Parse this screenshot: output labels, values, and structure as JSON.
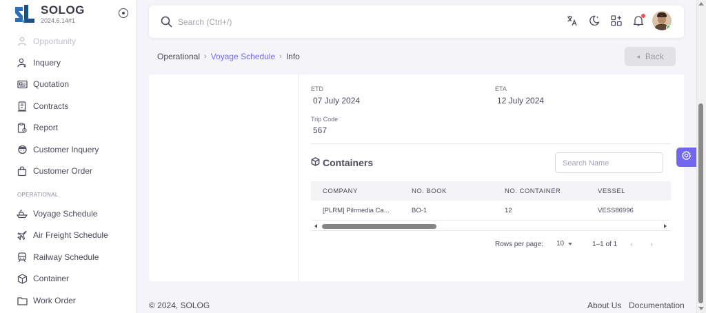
{
  "app": {
    "name": "SOLOG",
    "version": "2024.6.14#1"
  },
  "sidebar": {
    "items_top": [
      {
        "label": "Opportunity",
        "icon": "opportunity-icon"
      },
      {
        "label": "Inquery",
        "icon": "user-inquiry-icon"
      },
      {
        "label": "Quotation",
        "icon": "quotation-icon"
      },
      {
        "label": "Contracts",
        "icon": "contracts-icon"
      },
      {
        "label": "Report",
        "icon": "report-icon"
      },
      {
        "label": "Customer Inquery",
        "icon": "customer-inquiry-icon"
      },
      {
        "label": "Customer Order",
        "icon": "shopping-bag-icon"
      }
    ],
    "section_label": "OPERATIONAL",
    "items_operational": [
      {
        "label": "Voyage Schedule",
        "icon": "ship-icon"
      },
      {
        "label": "Air Freight Schedule",
        "icon": "plane-icon"
      },
      {
        "label": "Railway Schedule",
        "icon": "train-icon"
      },
      {
        "label": "Container",
        "icon": "box-icon"
      },
      {
        "label": "Work Order",
        "icon": "folder-icon"
      }
    ]
  },
  "topbar": {
    "search_placeholder": "Search (Ctrl+/)"
  },
  "breadcrumb": {
    "items": [
      "Operational",
      "Voyage Schedule",
      "Info"
    ],
    "separator": "›"
  },
  "back_button": {
    "label": "Back"
  },
  "info": {
    "etd_label": "ETD",
    "etd_value": "07 July 2024",
    "eta_label": "ETA",
    "eta_value": "12 July 2024",
    "trip_code_label": "Trip Code",
    "trip_code_value": "567"
  },
  "containers": {
    "title": "Containers",
    "search_placeholder": "Search Name",
    "columns": [
      "COMPANY",
      "NO. BOOK",
      "NO. CONTAINER",
      "VESSEL"
    ],
    "rows": [
      [
        "[PLRM] Pilrmedia Ca...",
        "BO-1",
        "12",
        "VESS86996"
      ]
    ],
    "rows_per_page_label": "Rows per page:",
    "rows_per_page_value": "10",
    "range_text": "1–1 of 1"
  },
  "footer": {
    "copyright": "© 2024, SOLOG",
    "links": [
      "About Us",
      "Documentation"
    ]
  },
  "colors": {
    "primary": "#7367f0",
    "text": "#4b4b5a",
    "notification": "#ff4c51",
    "online": "#4cc94f"
  }
}
